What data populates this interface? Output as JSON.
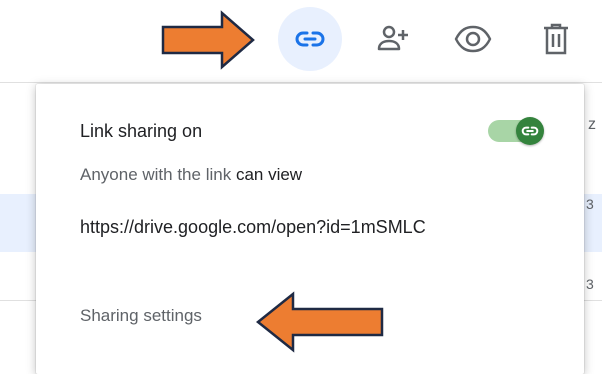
{
  "background": {
    "side_text_top": "z",
    "side_text_mid": "3",
    "side_text_bot": "3"
  },
  "toolbar": {
    "link_button": {
      "icon": "link-icon"
    },
    "add_person_button": {
      "icon": "person-add-icon"
    },
    "preview_button": {
      "icon": "eye-icon"
    },
    "delete_button": {
      "icon": "trash-icon"
    }
  },
  "popup": {
    "title": "Link sharing on",
    "toggle_on": true,
    "access_prefix": "Anyone with the link",
    "access_level": "can view",
    "link_url": "https://drive.google.com/open?id=1mSMLC",
    "sharing_settings_label": "Sharing settings"
  },
  "colors": {
    "accent_blue": "#1a73e8",
    "active_bg": "#e8f0fe",
    "toggle_green": "#34833d",
    "toggle_track": "#a8d5a6",
    "annotation_orange": "#ed7d31",
    "icon_gray": "#5f6368"
  }
}
